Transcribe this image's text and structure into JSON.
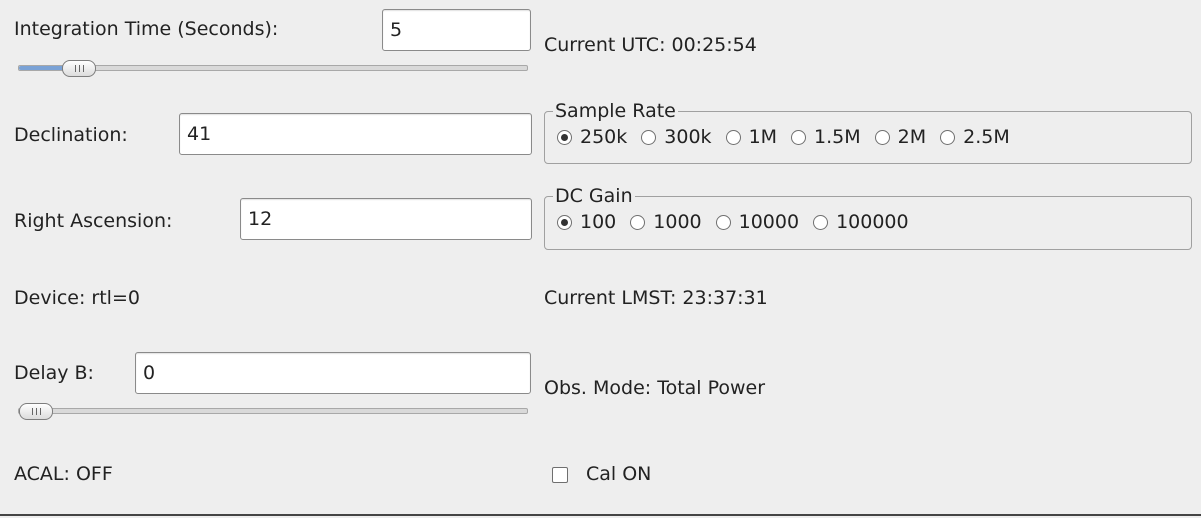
{
  "integration": {
    "label": "Integration Time (Seconds):",
    "value": "5",
    "slider_fraction": 0.09
  },
  "utc": {
    "label": "Current UTC: 00:25:54"
  },
  "declination": {
    "label": "Declination:",
    "value": "41"
  },
  "sample_rate": {
    "title": "Sample Rate",
    "options": [
      "250k",
      "300k",
      "1M",
      "1.5M",
      "2M",
      "2.5M"
    ],
    "selected": "250k"
  },
  "right_ascension": {
    "label": "Right Ascension:",
    "value": "12"
  },
  "dc_gain": {
    "title": "DC Gain",
    "options": [
      "100",
      "1000",
      "10000",
      "100000"
    ],
    "selected": "100"
  },
  "device": {
    "label": "Device: rtl=0"
  },
  "lmst": {
    "label": "Current LMST: 23:37:31"
  },
  "delay_b": {
    "label": "Delay B:",
    "value": "0",
    "slider_fraction": 0.0
  },
  "obs_mode": {
    "label": "Obs. Mode: Total Power"
  },
  "acal": {
    "label": "ACAL: OFF"
  },
  "cal": {
    "label": "Cal ON",
    "checked": false
  },
  "colors": {
    "background": "#eeeeee",
    "slider_fill": "#7aa2d6",
    "text": "#222222"
  }
}
